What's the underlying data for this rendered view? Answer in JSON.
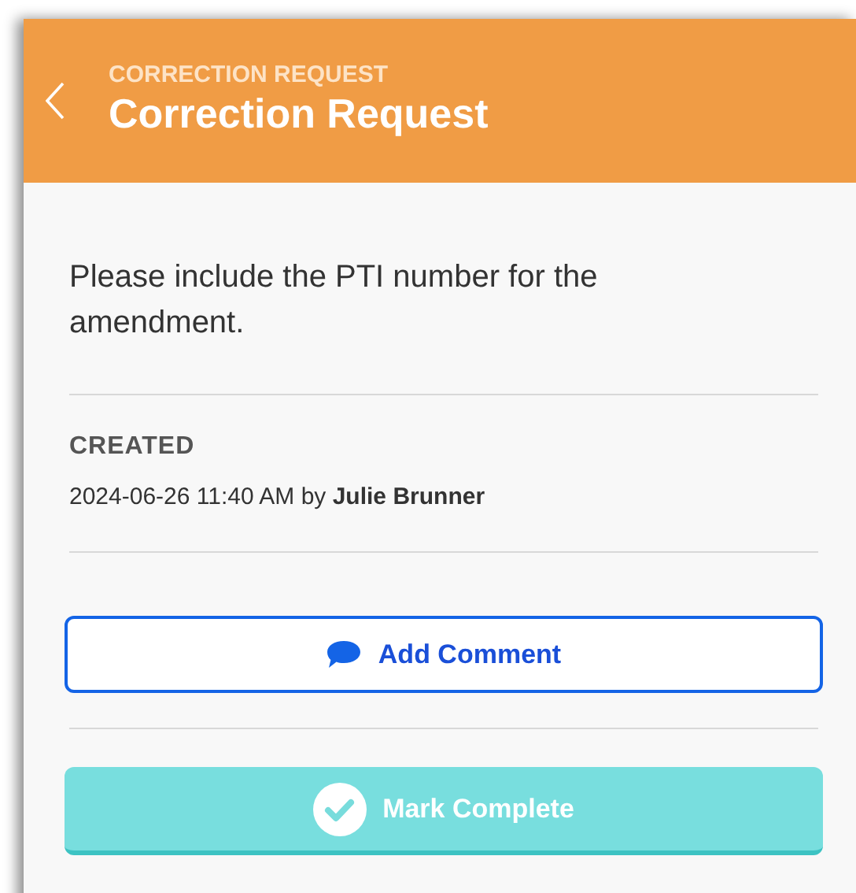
{
  "header": {
    "subtitle": "CORRECTION REQUEST",
    "title": "Correction Request"
  },
  "message": "Please include the PTI number for the amendment.",
  "created": {
    "label": "CREATED",
    "value": "2024-06-26 11:40 AM by **Julie Brunner**"
  },
  "buttons": [
    {
      "kind": "outline",
      "label": "Add Comment"
    },
    {
      "kind": "filled",
      "label": "Mark Complete"
    }
  ]
}
